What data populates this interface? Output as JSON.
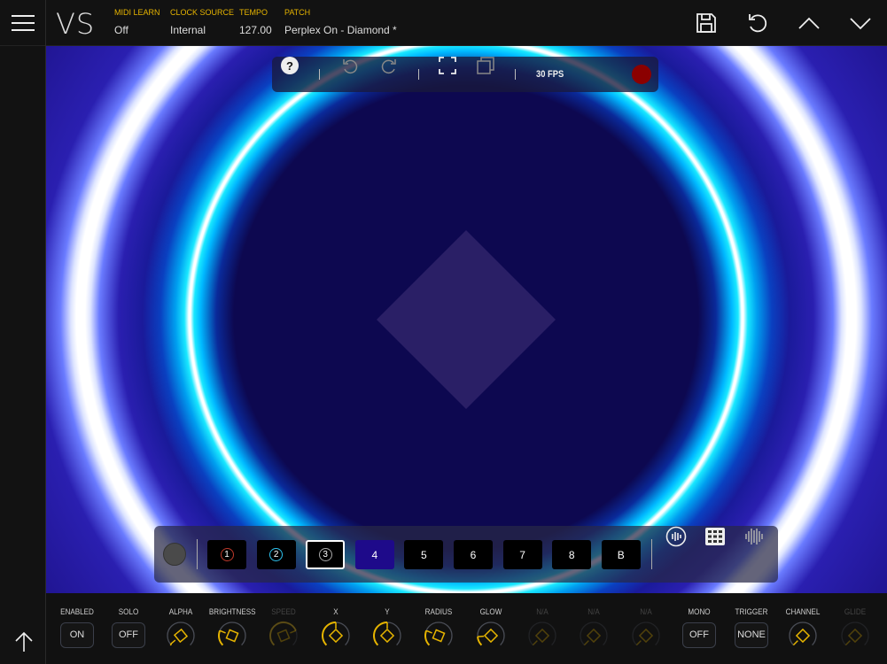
{
  "header": {
    "logo": "VS",
    "fields": [
      {
        "label": "MIDI LEARN",
        "value": "Off"
      },
      {
        "label": "CLOCK SOURCE",
        "value": "Internal"
      },
      {
        "label": "TEMPO",
        "value": "127.00"
      },
      {
        "label": "PATCH",
        "value": "Perplex On - Diamond *"
      }
    ]
  },
  "toolbar": {
    "fps": "30 FPS"
  },
  "layers": [
    {
      "label": "1",
      "style": "ring",
      "ring": "#c0392b"
    },
    {
      "label": "2",
      "style": "ring",
      "ring": "#2ec4f0"
    },
    {
      "label": "3",
      "style": "ring",
      "ring": "#aaaaaa",
      "selected": true
    },
    {
      "label": "4",
      "active": true
    },
    {
      "label": "5"
    },
    {
      "label": "6"
    },
    {
      "label": "7"
    },
    {
      "label": "8"
    },
    {
      "label": "B"
    }
  ],
  "controls": [
    {
      "label": "ENABLED",
      "type": "button",
      "value": "ON"
    },
    {
      "label": "SOLO",
      "type": "button",
      "value": "OFF"
    },
    {
      "label": "ALPHA",
      "type": "knob",
      "value": 0.02,
      "shape": "square"
    },
    {
      "label": "BRIGHTNESS",
      "type": "knob",
      "value": 0.25,
      "shape": "square"
    },
    {
      "label": "SPEED",
      "type": "knob",
      "value": 0.75,
      "shape": "square",
      "disabled": true
    },
    {
      "label": "X",
      "type": "knob",
      "value": 0.5,
      "shape": "diamond"
    },
    {
      "label": "Y",
      "type": "knob",
      "value": 0.5,
      "shape": "diamond"
    },
    {
      "label": "RADIUS",
      "type": "knob",
      "value": 0.25,
      "shape": "square"
    },
    {
      "label": "GLOW",
      "type": "knob",
      "value": 0.15,
      "shape": "diamond"
    },
    {
      "label": "N/A",
      "type": "knob",
      "value": 0,
      "shape": "square",
      "disabled": true
    },
    {
      "label": "N/A",
      "type": "knob",
      "value": 0,
      "shape": "square",
      "disabled": true
    },
    {
      "label": "N/A",
      "type": "knob",
      "value": 0,
      "shape": "square",
      "disabled": true
    },
    {
      "label": "MONO",
      "type": "button",
      "value": "OFF"
    },
    {
      "label": "TRIGGER",
      "type": "button",
      "value": "NONE"
    },
    {
      "label": "CHANNEL",
      "type": "knob",
      "value": 0,
      "shape": "square"
    },
    {
      "label": "GLIDE",
      "type": "knob",
      "value": 0,
      "shape": "square",
      "disabled": true
    }
  ],
  "colors": {
    "accent": "#e6b400",
    "record": "#8b0000",
    "canvas_bg": "#0b0648",
    "ring_inner": "#00e5ff",
    "diamond": "#2a1f66"
  }
}
